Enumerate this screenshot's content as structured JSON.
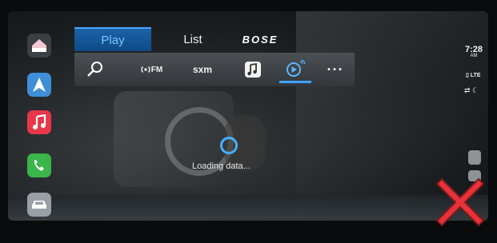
{
  "tabs": {
    "play_label": "Play",
    "list_label": "List",
    "brand_label": "BOSE"
  },
  "sources": {
    "fm_label": "FM",
    "sxm_label": "sxm",
    "more_label": "···"
  },
  "loading": {
    "text": "Loading data..."
  },
  "status": {
    "time": "7:28",
    "ampm": "AM",
    "network": "LTE"
  },
  "icons": {
    "home": "home-icon",
    "maps": "maps-icon",
    "music": "music-icon",
    "phone": "phone-icon",
    "car": "car-icon",
    "search": "search-icon",
    "airplay": "airplay-audio-icon",
    "overlay": "red-x-icon"
  },
  "colors": {
    "accent": "#3fa3ff",
    "tab_active": "#1b63a8",
    "error_x": "#e8323a"
  }
}
